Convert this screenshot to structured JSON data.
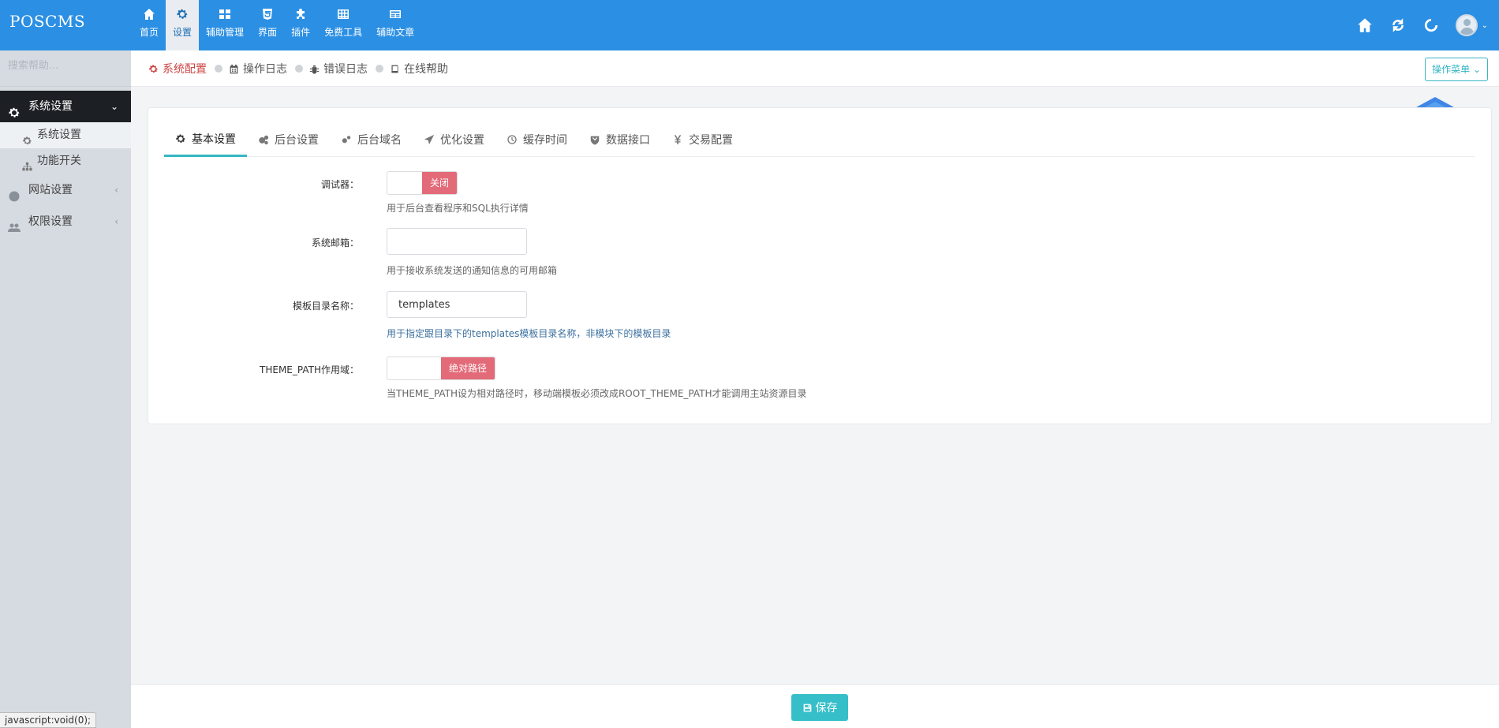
{
  "app": {
    "logo": "POSCMS"
  },
  "topnav": [
    {
      "label": "首页",
      "icon": "home-icon"
    },
    {
      "label": "设置",
      "icon": "gear-icon"
    },
    {
      "label": "辅助管理",
      "icon": "grid-icon"
    },
    {
      "label": "界面",
      "icon": "html5-icon"
    },
    {
      "label": "插件",
      "icon": "puzzle-icon"
    },
    {
      "label": "免费工具",
      "icon": "table-icon"
    },
    {
      "label": "辅助文章",
      "icon": "newspaper-icon"
    }
  ],
  "topnav_active_index": 1,
  "topright_icons": [
    "home-icon",
    "refresh-icon",
    "spinner-icon",
    "avatar"
  ],
  "sidebar": {
    "search_placeholder": "搜索帮助...",
    "groups": [
      {
        "label": "系统设置",
        "icon": "gear-icon",
        "open": true,
        "arrow": "⌄"
      },
      {
        "label": "网站设置",
        "icon": "globe-icon",
        "open": false,
        "arrow": "‹"
      },
      {
        "label": "权限设置",
        "icon": "users-icon",
        "open": false,
        "arrow": "‹"
      }
    ],
    "items": [
      {
        "label": "系统设置",
        "icon": "gear-icon",
        "active": true
      },
      {
        "label": "功能开关",
        "icon": "sitemap-icon",
        "active": false
      }
    ]
  },
  "status_url": "javascript:void(0);",
  "breadcrumb": [
    {
      "label": "系统配置",
      "icon": "gear-icon",
      "active": true
    },
    {
      "label": "操作日志",
      "icon": "calendar-icon",
      "active": false
    },
    {
      "label": "错误日志",
      "icon": "bug-icon",
      "active": false
    },
    {
      "label": "在线帮助",
      "icon": "book-icon",
      "active": false
    }
  ],
  "operation_menu": "操作菜单 ⌄",
  "tabs": [
    {
      "label": "基本设置",
      "icon": "gear-icon",
      "active": true
    },
    {
      "label": "后台设置",
      "icon": "cogs-icon",
      "active": false
    },
    {
      "label": "后台域名",
      "icon": "cogs-small-icon",
      "active": false
    },
    {
      "label": "优化设置",
      "icon": "send-icon",
      "active": false
    },
    {
      "label": "缓存时间",
      "icon": "clock-icon",
      "active": false
    },
    {
      "label": "数据接口",
      "icon": "shield-icon",
      "active": false
    },
    {
      "label": "交易配置",
      "icon": "yen-icon",
      "active": false
    }
  ],
  "form": {
    "debugger": {
      "label": "调试器：",
      "toggle_text": "关闭",
      "help": "用于后台查看程序和SQL执行详情"
    },
    "email": {
      "label": "系统邮箱：",
      "value": "",
      "help": "用于接收系统发送的通知信息的可用邮箱"
    },
    "template_dir": {
      "label": "模板目录名称：",
      "value": "templates",
      "help": "用于指定跟目录下的templates模板目录名称，非模块下的模板目录"
    },
    "theme_path": {
      "label": "THEME_PATH作用域：",
      "toggle_text": "绝对路径",
      "help": "当THEME_PATH设为相对路径时，移动端模板必须改成ROOT_THEME_PATH才能调用主站资源目录"
    }
  },
  "save_button": "保存",
  "colors": {
    "topbar": "#2b8fe3",
    "accent": "#36b6c5",
    "toggle_on": "#e36a78",
    "active_crumb": "#cc4444",
    "sidebar": "#d6dbe1"
  }
}
